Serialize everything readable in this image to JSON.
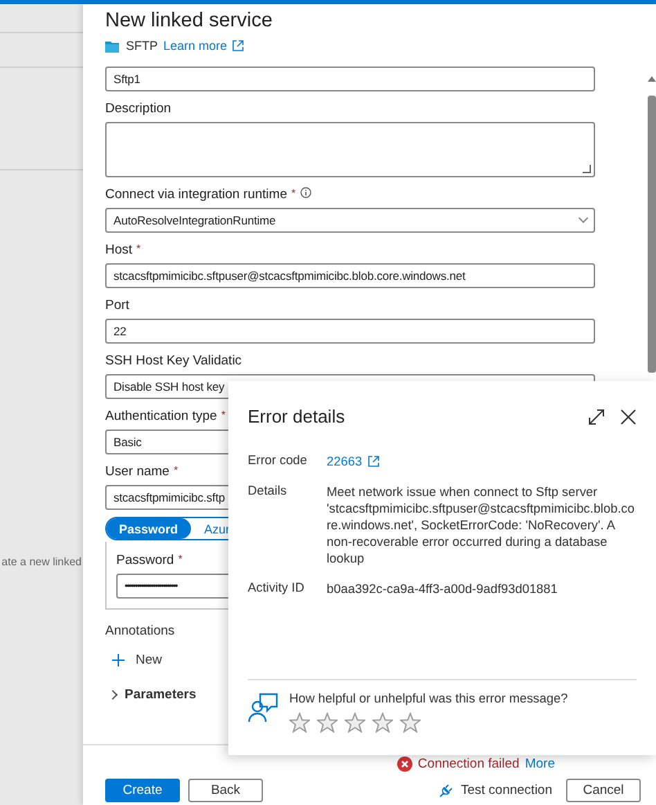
{
  "sidebar": {
    "text": "ate a new linked"
  },
  "header": {
    "title": "New linked service",
    "connector": "SFTP",
    "link": "Learn more"
  },
  "fields": [
    {
      "kind": "text",
      "value": "Sftp1"
    },
    {
      "kind": "textarea",
      "label": "Description"
    },
    {
      "kind": "select",
      "label": "Connect via integration runtime",
      "required_mark": "*",
      "info": true,
      "value": "AutoResolveIntegrationRuntime"
    },
    {
      "kind": "text",
      "label": "Host",
      "required_mark": "*",
      "value": "stcacsftpmimicibc.sftpuser@stcacsftpmimicibc.blob.core.windows.net"
    },
    {
      "kind": "text",
      "label": "Port",
      "value": "22"
    },
    {
      "kind": "select",
      "label": "SSH Host Key Validatic",
      "value": "Disable SSH host key"
    },
    {
      "kind": "select",
      "label": "Authentication type",
      "required_mark": "*",
      "value": "Basic"
    },
    {
      "kind": "text",
      "label": "User name",
      "required_mark": "*",
      "value": "stcacsftpmimicibc.sftp"
    }
  ],
  "auth_toggle": [
    {
      "label": "Password",
      "selected": true
    },
    {
      "label": "Azur",
      "selected": false
    }
  ],
  "password": {
    "label": "Password",
    "required_mark": "*",
    "value": "••••••••••••••••••••••••••"
  },
  "annotations": {
    "title": "Annotations",
    "new": "New"
  },
  "sections": [
    {
      "label": "Parameters",
      "expanded": false
    }
  ],
  "status": {
    "text": "Connection failed",
    "link": "More"
  },
  "buttons": [
    {
      "label": "Create",
      "kind": "primary"
    },
    {
      "label": "Back",
      "kind": "default"
    }
  ],
  "test_connection": "Test connection",
  "cancel": "Cancel",
  "error": {
    "title": "Error details",
    "rows": [
      {
        "label": "Error code",
        "value": "22663",
        "kind": "link"
      },
      {
        "label": "Details",
        "value": "Meet network issue when connect to Sftp server 'stcacsftpmimicibc.sftpuser@stcacsftpmimicibc.blob.core.windows.net', SocketErrorCode: 'NoRecovery'. A non-recoverable error occurred during a database lookup",
        "kind": "text"
      },
      {
        "label": "Activity ID",
        "value": "b0aa392c-ca9a-4ff3-a00d-9adf93d01881",
        "kind": "text"
      }
    ],
    "feedback": "How helpful or unhelpful was this error message?",
    "stars": 0
  }
}
